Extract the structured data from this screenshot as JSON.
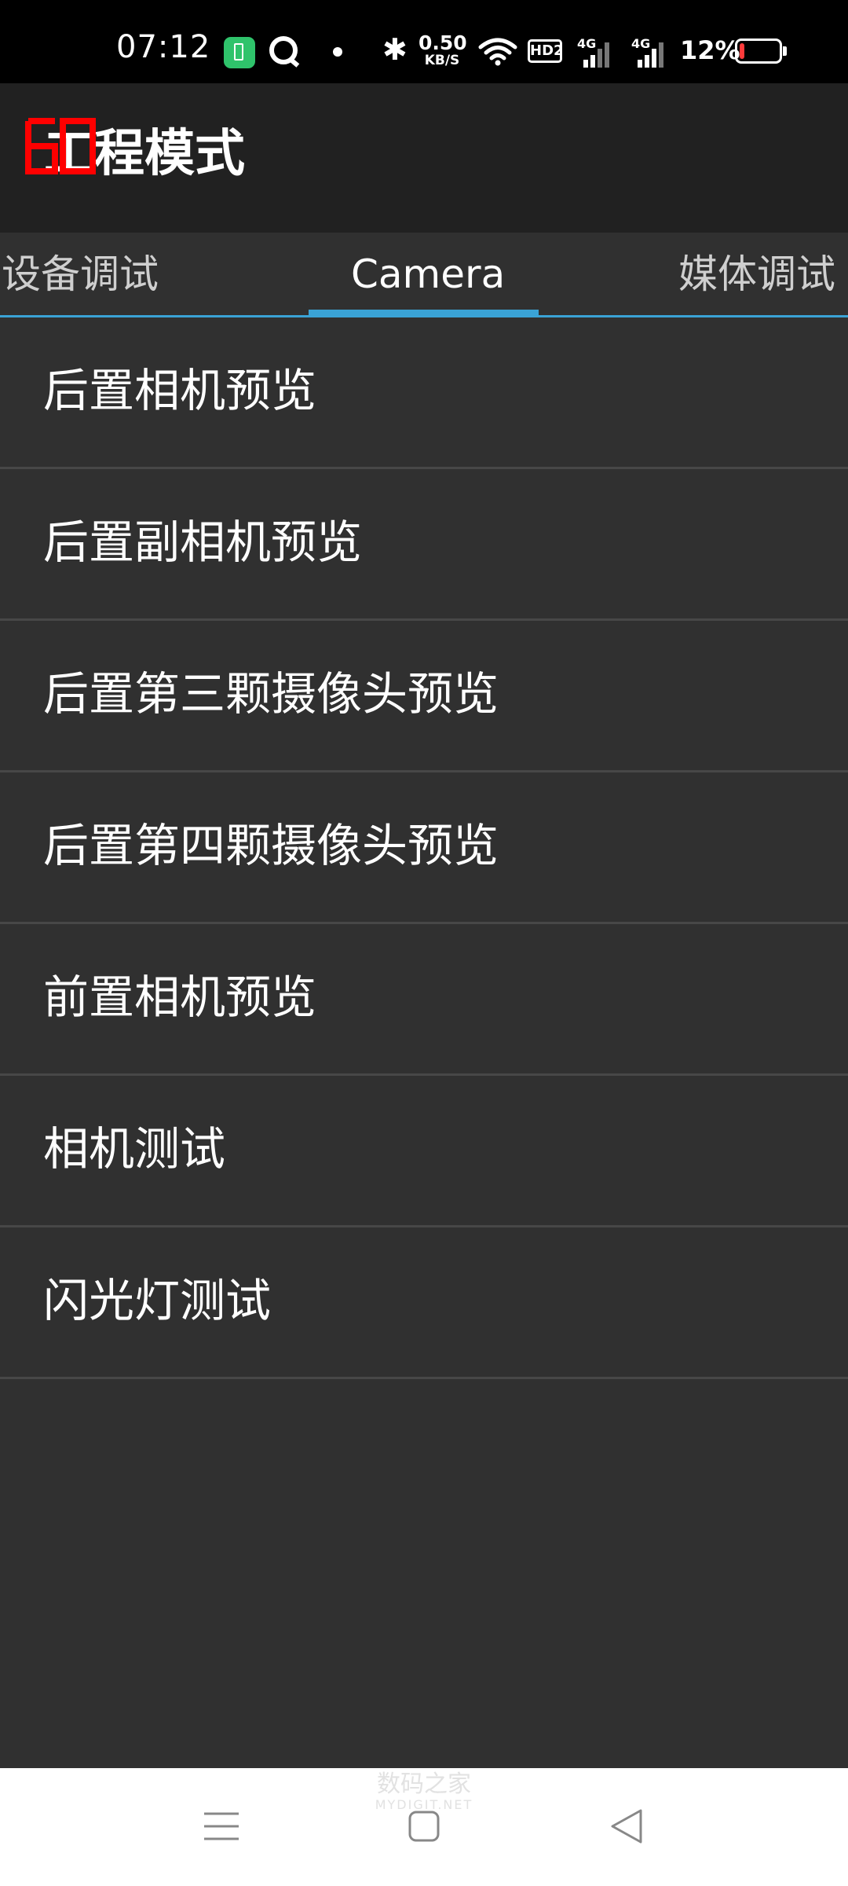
{
  "status_bar": {
    "time": "07:12",
    "net_speed_value": "0.50",
    "net_speed_unit": "KB/S",
    "hd_label": "HD2",
    "sim1_label": "4G",
    "sim2_label": "4G",
    "battery_percent": "12%",
    "battery_level": 0.12,
    "bluetooth_glyph": "✱"
  },
  "app_bar": {
    "title": "工程模式",
    "logo_color": "#ff0000"
  },
  "tabs": [
    {
      "label": "设备调试",
      "active": false
    },
    {
      "label": "Camera",
      "active": true
    },
    {
      "label": "媒体调试",
      "active": false
    }
  ],
  "list": [
    {
      "label": "后置相机预览"
    },
    {
      "label": "后置副相机预览"
    },
    {
      "label": "后置第三颗摄像头预览"
    },
    {
      "label": "后置第四颗摄像头预览"
    },
    {
      "label": "前置相机预览"
    },
    {
      "label": "相机测试"
    },
    {
      "label": "闪光灯测试"
    }
  ],
  "watermark": {
    "line1": "数码之家",
    "line2": "MYDIGIT.NET"
  },
  "colors": {
    "accent": "#3aa3d6",
    "background": "#303030",
    "app_bar": "#212121",
    "battery_low": "#ff3b3b"
  },
  "icons": {
    "nav_menu": "menu-icon",
    "nav_home": "home-icon",
    "nav_back": "back-icon"
  }
}
